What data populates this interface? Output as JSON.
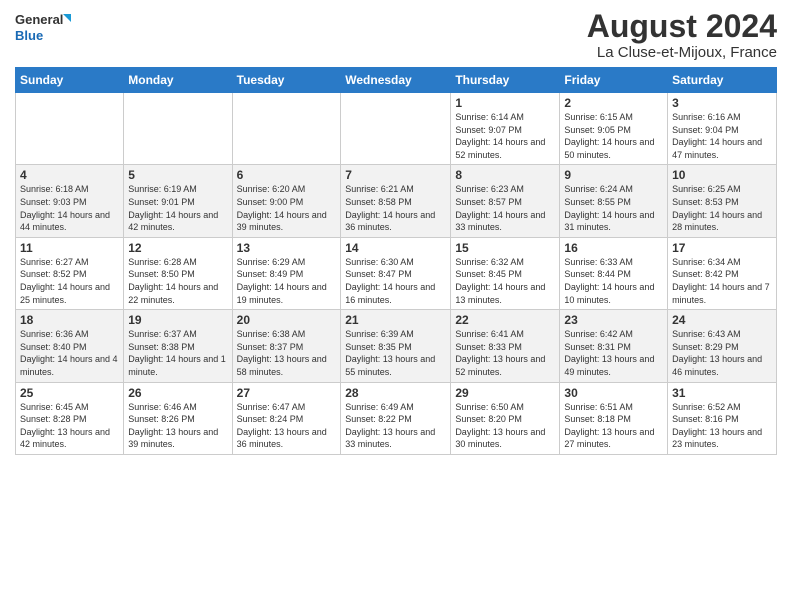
{
  "header": {
    "logo_line1": "General",
    "logo_line2": "Blue",
    "month_year": "August 2024",
    "location": "La Cluse-et-Mijoux, France"
  },
  "days_of_week": [
    "Sunday",
    "Monday",
    "Tuesday",
    "Wednesday",
    "Thursday",
    "Friday",
    "Saturday"
  ],
  "weeks": [
    [
      {
        "day": "",
        "info": ""
      },
      {
        "day": "",
        "info": ""
      },
      {
        "day": "",
        "info": ""
      },
      {
        "day": "",
        "info": ""
      },
      {
        "day": "1",
        "info": "Sunrise: 6:14 AM\nSunset: 9:07 PM\nDaylight: 14 hours and 52 minutes."
      },
      {
        "day": "2",
        "info": "Sunrise: 6:15 AM\nSunset: 9:05 PM\nDaylight: 14 hours and 50 minutes."
      },
      {
        "day": "3",
        "info": "Sunrise: 6:16 AM\nSunset: 9:04 PM\nDaylight: 14 hours and 47 minutes."
      }
    ],
    [
      {
        "day": "4",
        "info": "Sunrise: 6:18 AM\nSunset: 9:03 PM\nDaylight: 14 hours and 44 minutes."
      },
      {
        "day": "5",
        "info": "Sunrise: 6:19 AM\nSunset: 9:01 PM\nDaylight: 14 hours and 42 minutes."
      },
      {
        "day": "6",
        "info": "Sunrise: 6:20 AM\nSunset: 9:00 PM\nDaylight: 14 hours and 39 minutes."
      },
      {
        "day": "7",
        "info": "Sunrise: 6:21 AM\nSunset: 8:58 PM\nDaylight: 14 hours and 36 minutes."
      },
      {
        "day": "8",
        "info": "Sunrise: 6:23 AM\nSunset: 8:57 PM\nDaylight: 14 hours and 33 minutes."
      },
      {
        "day": "9",
        "info": "Sunrise: 6:24 AM\nSunset: 8:55 PM\nDaylight: 14 hours and 31 minutes."
      },
      {
        "day": "10",
        "info": "Sunrise: 6:25 AM\nSunset: 8:53 PM\nDaylight: 14 hours and 28 minutes."
      }
    ],
    [
      {
        "day": "11",
        "info": "Sunrise: 6:27 AM\nSunset: 8:52 PM\nDaylight: 14 hours and 25 minutes."
      },
      {
        "day": "12",
        "info": "Sunrise: 6:28 AM\nSunset: 8:50 PM\nDaylight: 14 hours and 22 minutes."
      },
      {
        "day": "13",
        "info": "Sunrise: 6:29 AM\nSunset: 8:49 PM\nDaylight: 14 hours and 19 minutes."
      },
      {
        "day": "14",
        "info": "Sunrise: 6:30 AM\nSunset: 8:47 PM\nDaylight: 14 hours and 16 minutes."
      },
      {
        "day": "15",
        "info": "Sunrise: 6:32 AM\nSunset: 8:45 PM\nDaylight: 14 hours and 13 minutes."
      },
      {
        "day": "16",
        "info": "Sunrise: 6:33 AM\nSunset: 8:44 PM\nDaylight: 14 hours and 10 minutes."
      },
      {
        "day": "17",
        "info": "Sunrise: 6:34 AM\nSunset: 8:42 PM\nDaylight: 14 hours and 7 minutes."
      }
    ],
    [
      {
        "day": "18",
        "info": "Sunrise: 6:36 AM\nSunset: 8:40 PM\nDaylight: 14 hours and 4 minutes."
      },
      {
        "day": "19",
        "info": "Sunrise: 6:37 AM\nSunset: 8:38 PM\nDaylight: 14 hours and 1 minute."
      },
      {
        "day": "20",
        "info": "Sunrise: 6:38 AM\nSunset: 8:37 PM\nDaylight: 13 hours and 58 minutes."
      },
      {
        "day": "21",
        "info": "Sunrise: 6:39 AM\nSunset: 8:35 PM\nDaylight: 13 hours and 55 minutes."
      },
      {
        "day": "22",
        "info": "Sunrise: 6:41 AM\nSunset: 8:33 PM\nDaylight: 13 hours and 52 minutes."
      },
      {
        "day": "23",
        "info": "Sunrise: 6:42 AM\nSunset: 8:31 PM\nDaylight: 13 hours and 49 minutes."
      },
      {
        "day": "24",
        "info": "Sunrise: 6:43 AM\nSunset: 8:29 PM\nDaylight: 13 hours and 46 minutes."
      }
    ],
    [
      {
        "day": "25",
        "info": "Sunrise: 6:45 AM\nSunset: 8:28 PM\nDaylight: 13 hours and 42 minutes."
      },
      {
        "day": "26",
        "info": "Sunrise: 6:46 AM\nSunset: 8:26 PM\nDaylight: 13 hours and 39 minutes."
      },
      {
        "day": "27",
        "info": "Sunrise: 6:47 AM\nSunset: 8:24 PM\nDaylight: 13 hours and 36 minutes."
      },
      {
        "day": "28",
        "info": "Sunrise: 6:49 AM\nSunset: 8:22 PM\nDaylight: 13 hours and 33 minutes."
      },
      {
        "day": "29",
        "info": "Sunrise: 6:50 AM\nSunset: 8:20 PM\nDaylight: 13 hours and 30 minutes."
      },
      {
        "day": "30",
        "info": "Sunrise: 6:51 AM\nSunset: 8:18 PM\nDaylight: 13 hours and 27 minutes."
      },
      {
        "day": "31",
        "info": "Sunrise: 6:52 AM\nSunset: 8:16 PM\nDaylight: 13 hours and 23 minutes."
      }
    ]
  ]
}
